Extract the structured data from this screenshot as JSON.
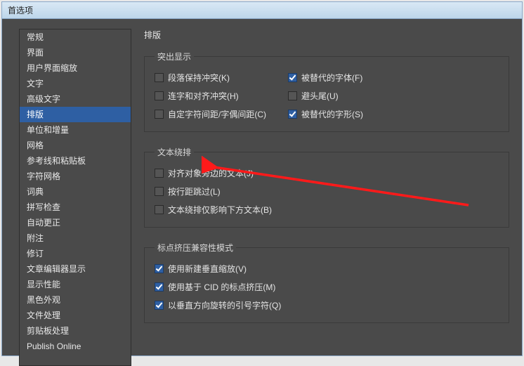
{
  "window": {
    "title": "首选项"
  },
  "sidebar": {
    "items": [
      "常规",
      "界面",
      "用户界面缩放",
      "文字",
      "高级文字",
      "排版",
      "单位和增量",
      "网格",
      "参考线和粘贴板",
      "字符网格",
      "词典",
      "拼写检查",
      "自动更正",
      "附注",
      "修订",
      "文章编辑器显示",
      "显示性能",
      "黑色外观",
      "文件处理",
      "剪贴板处理",
      "Publish Online"
    ],
    "selectedIndex": 5
  },
  "main": {
    "title": "排版",
    "group1": {
      "legend": "突出显示",
      "opts": [
        {
          "label": "段落保持冲突(K)",
          "checked": false
        },
        {
          "label": "被替代的字体(F)",
          "checked": true
        },
        {
          "label": "连字和对齐冲突(H)",
          "checked": false
        },
        {
          "label": "避头尾(U)",
          "checked": false
        },
        {
          "label": "自定字符间距/字偶间距(C)",
          "checked": false
        },
        {
          "label": "被替代的字形(S)",
          "checked": true
        }
      ]
    },
    "group2": {
      "legend": "文本绕排",
      "opts": [
        {
          "label": "对齐对象旁边的文本(J)",
          "checked": false
        },
        {
          "label": "按行距跳过(L)",
          "checked": false
        },
        {
          "label": "文本绕排仅影响下方文本(B)",
          "checked": false
        }
      ]
    },
    "group3": {
      "legend": "标点挤压兼容性模式",
      "opts": [
        {
          "label": "使用新建垂直缩放(V)",
          "checked": true
        },
        {
          "label": "使用基于 CID 的标点挤压(M)",
          "checked": true
        },
        {
          "label": "以垂直方向旋转的引号字符(Q)",
          "checked": true
        }
      ]
    }
  }
}
